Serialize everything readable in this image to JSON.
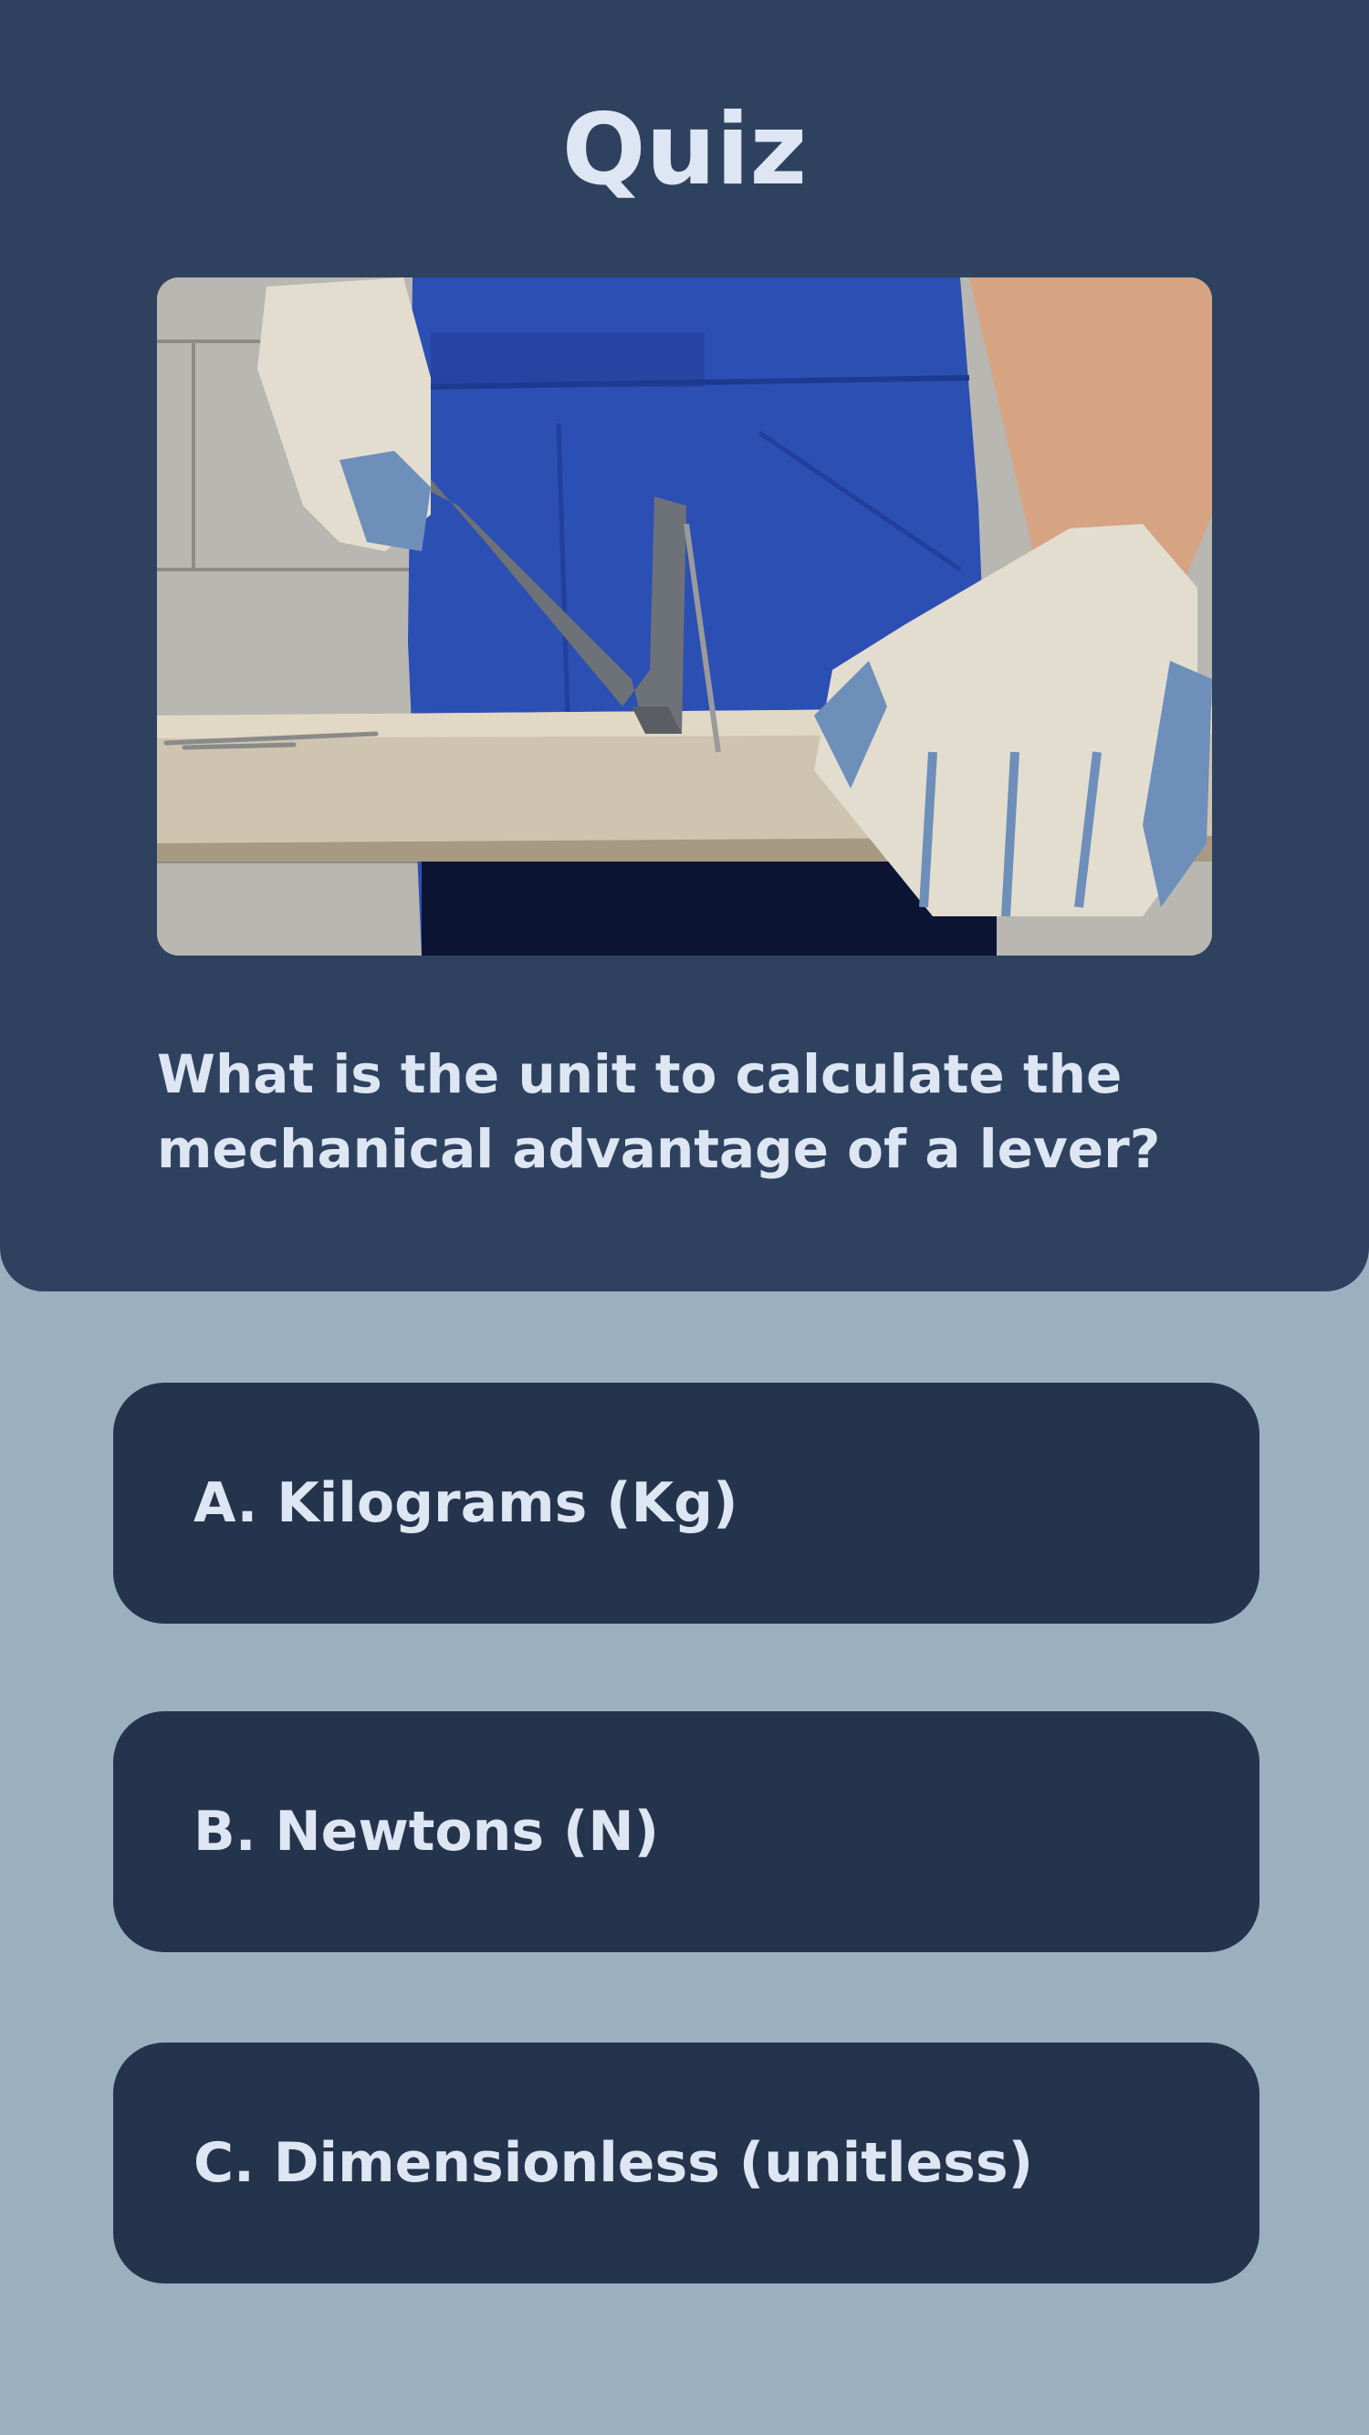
{
  "quiz": {
    "title": "Quiz",
    "question": "What is the unit to calculate the mechanical advantage of a lever?",
    "options": [
      {
        "label": "A. Kilograms (Kg)"
      },
      {
        "label": "B. Newtons (N)"
      },
      {
        "label": "C. Dimensionless (unitless)"
      }
    ]
  },
  "colors": {
    "page_background": "#9bb0bf",
    "header_background": "#2e4260",
    "option_background": "#25344d",
    "text": "#dde6f2"
  }
}
